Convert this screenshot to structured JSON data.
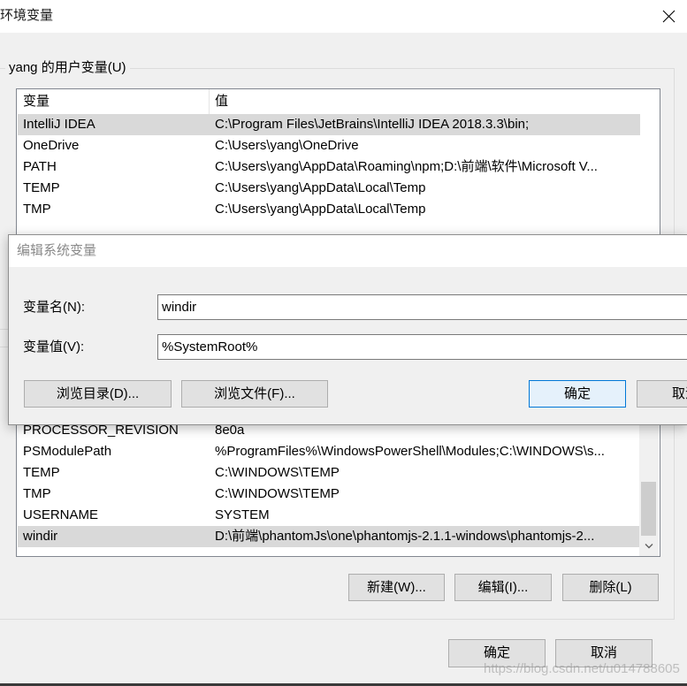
{
  "window": {
    "title": "环境变量",
    "close_icon": "close-icon"
  },
  "user_vars": {
    "group_label": "yang 的用户变量(U)",
    "columns": [
      "变量",
      "值"
    ],
    "rows": [
      {
        "name": "IntelliJ IDEA",
        "value": "C:\\Program Files\\JetBrains\\IntelliJ IDEA 2018.3.3\\bin;",
        "selected": true
      },
      {
        "name": "OneDrive",
        "value": "C:\\Users\\yang\\OneDrive",
        "selected": false
      },
      {
        "name": "PATH",
        "value": "C:\\Users\\yang\\AppData\\Roaming\\npm;D:\\前端\\软件\\Microsoft V...",
        "selected": false
      },
      {
        "name": "TEMP",
        "value": "C:\\Users\\yang\\AppData\\Local\\Temp",
        "selected": false
      },
      {
        "name": "TMP",
        "value": "C:\\Users\\yang\\AppData\\Local\\Temp",
        "selected": false
      }
    ]
  },
  "system_vars": {
    "rows": [
      {
        "name": "PROCESSOR_REVISION",
        "value": "8e0a",
        "selected": false
      },
      {
        "name": "PSModulePath",
        "value": "%ProgramFiles%\\WindowsPowerShell\\Modules;C:\\WINDOWS\\s...",
        "selected": false
      },
      {
        "name": "TEMP",
        "value": "C:\\WINDOWS\\TEMP",
        "selected": false
      },
      {
        "name": "TMP",
        "value": "C:\\WINDOWS\\TEMP",
        "selected": false
      },
      {
        "name": "USERNAME",
        "value": "SYSTEM",
        "selected": false
      },
      {
        "name": "windir",
        "value": "D:\\前端\\phantomJs\\one\\phantomjs-2.1.1-windows\\phantomjs-2...",
        "selected": true
      }
    ],
    "buttons": {
      "new": "新建(W)...",
      "edit": "编辑(I)...",
      "delete": "删除(L)"
    },
    "scroll_down_icon": "chevron-down-icon"
  },
  "footer": {
    "ok": "确定",
    "cancel": "取消"
  },
  "edit_dialog": {
    "title": "编辑系统变量",
    "name_label": "变量名(N):",
    "name_value": "windir",
    "value_label": "变量值(V):",
    "value_value": "%SystemRoot%",
    "browse_dir": "浏览目录(D)...",
    "browse_file": "浏览文件(F)...",
    "ok": "确定",
    "cancel": "取消"
  },
  "watermark": "https://blog.csdn.net/u014788605",
  "colors": {
    "accent": "#0078d7",
    "default_button_bg": "#e5f1fb",
    "selection": "#d9d9d9",
    "dialog_bg": "#f0f0f0",
    "button_bg": "#e1e1e1"
  }
}
